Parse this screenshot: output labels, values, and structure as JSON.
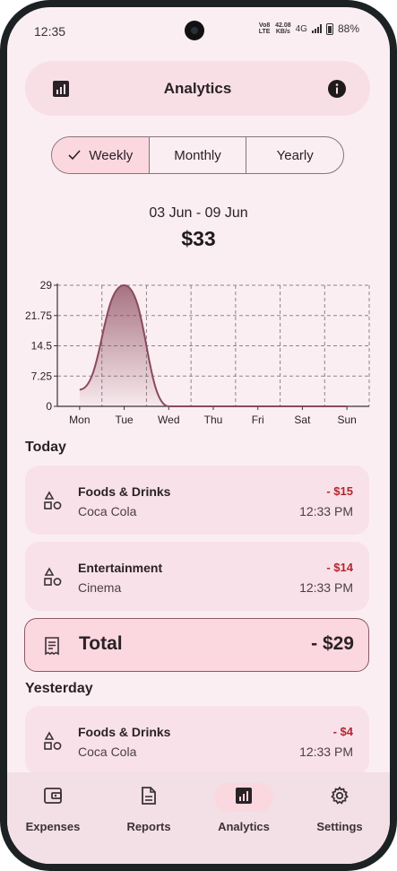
{
  "status": {
    "time": "12:35",
    "volte": "Vo8 LTE",
    "speed_top": "42.08",
    "speed_bottom": "KB/s",
    "network": "4G",
    "battery": "88%"
  },
  "appbar": {
    "title": "Analytics",
    "left_icon": "bar-chart-icon",
    "right_icon": "info-icon"
  },
  "period_tabs": [
    {
      "label": "Weekly",
      "selected": true
    },
    {
      "label": "Monthly",
      "selected": false
    },
    {
      "label": "Yearly",
      "selected": false
    }
  ],
  "summary": {
    "range": "03 Jun - 09 Jun",
    "amount": "$33"
  },
  "chart_data": {
    "type": "area",
    "categories": [
      "Mon",
      "Tue",
      "Wed",
      "Thu",
      "Fri",
      "Sat",
      "Sun"
    ],
    "values": [
      4,
      29,
      0,
      0,
      0,
      0,
      0
    ],
    "yticks": [
      "29",
      "21.75",
      "14.5",
      "7.25",
      "0"
    ],
    "ylim": [
      0,
      29
    ],
    "grid": true,
    "color": "#8a4a5c"
  },
  "sections": {
    "today": "Today",
    "yesterday": "Yesterday"
  },
  "today": [
    {
      "category": "Foods & Drinks",
      "item": "Coca Cola",
      "amount": "- $15",
      "time": "12:33 PM"
    },
    {
      "category": "Entertainment",
      "item": "Cinema",
      "amount": "- $14",
      "time": "12:33 PM"
    }
  ],
  "total": {
    "label": "Total",
    "value": "- $29"
  },
  "yesterday": [
    {
      "category": "Foods & Drinks",
      "item": "Coca Cola",
      "amount": "- $4",
      "time": "12:33 PM"
    }
  ],
  "nav": [
    {
      "label": "Expenses",
      "icon": "wallet-icon"
    },
    {
      "label": "Reports",
      "icon": "document-icon"
    },
    {
      "label": "Analytics",
      "icon": "bar-chart-icon",
      "active": true
    },
    {
      "label": "Settings",
      "icon": "gear-icon"
    }
  ]
}
